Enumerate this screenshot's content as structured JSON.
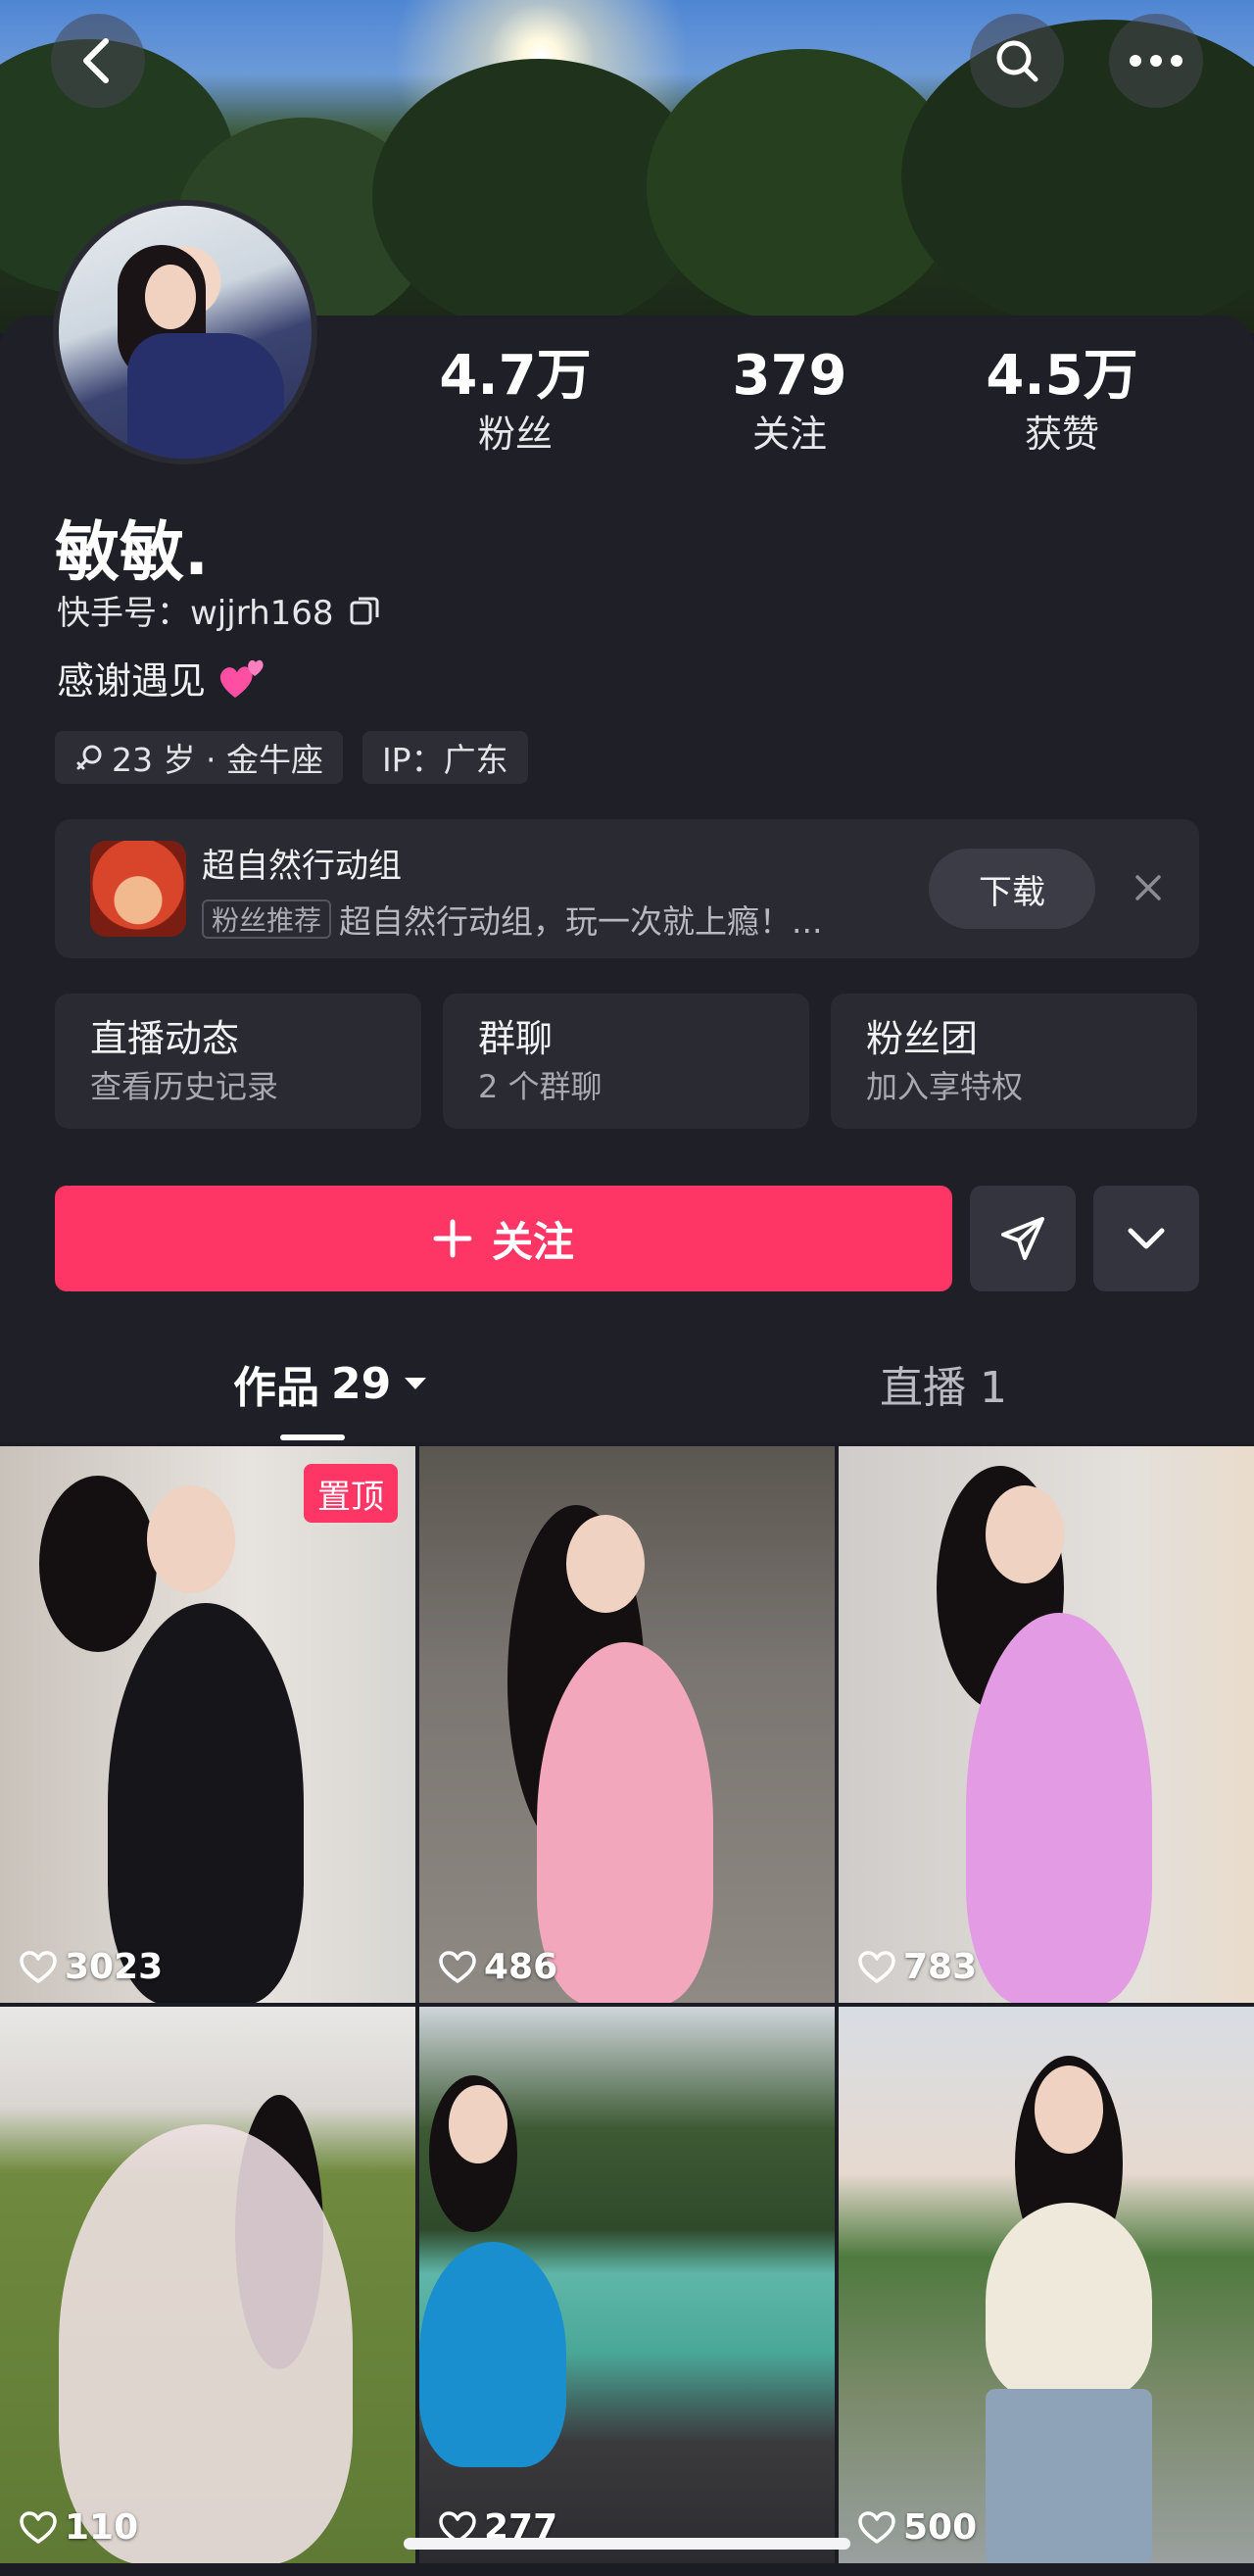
{
  "header": {
    "back_icon": "chevron-left-icon",
    "search_icon": "search-icon",
    "more_icon": "more-dots-icon"
  },
  "profile": {
    "stats": [
      {
        "value": "4.7万",
        "label": "粉丝"
      },
      {
        "value": "379",
        "label": "关注"
      },
      {
        "value": "4.5万",
        "label": "获赞"
      }
    ],
    "name": "敏敏.",
    "kuaishou_id": "快手号：wjjrh168",
    "bio": "感谢遇见",
    "tags": [
      {
        "label": "23 岁 · 金牛座"
      },
      {
        "label": "IP：广东"
      }
    ]
  },
  "promo": {
    "title": "超自然行动组",
    "badge": "粉丝推荐",
    "description": "超自然行动组，玩一次就上瘾！...",
    "download_label": "下载"
  },
  "features": [
    {
      "title": "直播动态",
      "subtitle": "查看历史记录"
    },
    {
      "title": "群聊",
      "subtitle": "2 个群聊"
    },
    {
      "title": "粉丝团",
      "subtitle": "加入享特权"
    }
  ],
  "actions": {
    "follow_label": "关注"
  },
  "tabs": {
    "works_label": "作品",
    "works_count": "29",
    "live_label": "直播 1"
  },
  "grid": [
    {
      "likes": "3023",
      "pinned": "置顶"
    },
    {
      "likes": "486"
    },
    {
      "likes": "783"
    },
    {
      "likes": "110"
    },
    {
      "likes": "277"
    },
    {
      "likes": "500"
    }
  ],
  "colors": {
    "accent": "#fe3666",
    "background": "#1f1f27",
    "card": "#2a2a33"
  }
}
